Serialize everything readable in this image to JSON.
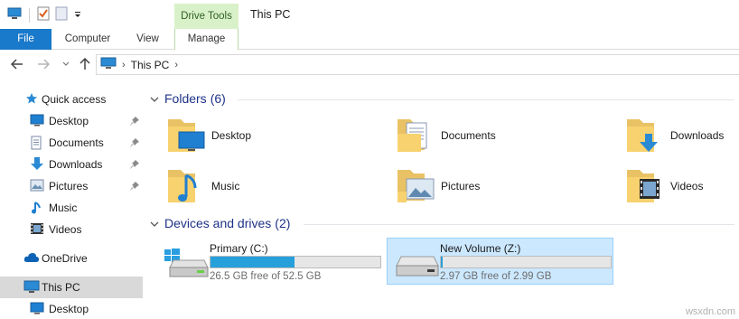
{
  "window": {
    "title": "This PC",
    "context_group": "Drive Tools"
  },
  "ribbon": {
    "tabs": [
      {
        "label": "File"
      },
      {
        "label": "Computer"
      },
      {
        "label": "View"
      },
      {
        "label": "Manage"
      }
    ]
  },
  "address": {
    "crumbs": [
      "This PC"
    ]
  },
  "navpane": {
    "items": [
      {
        "label": "Quick access",
        "icon": "star-icon"
      },
      {
        "label": "Desktop",
        "icon": "desktop-folder-icon",
        "pinned": true
      },
      {
        "label": "Documents",
        "icon": "documents-folder-icon",
        "pinned": true
      },
      {
        "label": "Downloads",
        "icon": "downloads-folder-icon",
        "pinned": true
      },
      {
        "label": "Pictures",
        "icon": "pictures-folder-icon",
        "pinned": true
      },
      {
        "label": "Music",
        "icon": "music-folder-icon"
      },
      {
        "label": "Videos",
        "icon": "videos-folder-icon"
      },
      {
        "label": "OneDrive",
        "icon": "onedrive-cloud-icon"
      },
      {
        "label": "This PC",
        "icon": "computer-icon",
        "selected": true
      },
      {
        "label": "Desktop",
        "icon": "desktop-folder-icon"
      }
    ]
  },
  "folders": {
    "title": "Folders",
    "count": "(6)",
    "items": [
      {
        "label": "Desktop",
        "icon": "desktop-folder-icon"
      },
      {
        "label": "Documents",
        "icon": "documents-folder-icon"
      },
      {
        "label": "Downloads",
        "icon": "downloads-folder-icon"
      },
      {
        "label": "Music",
        "icon": "music-folder-icon"
      },
      {
        "label": "Pictures",
        "icon": "pictures-folder-icon"
      },
      {
        "label": "Videos",
        "icon": "videos-folder-icon"
      }
    ]
  },
  "drives": {
    "title": "Devices and drives",
    "count": "(2)",
    "items": [
      {
        "label": "Primary (C:)",
        "free_text": "26.5 GB free of 52.5 GB",
        "used_fraction": 0.495,
        "selected": false
      },
      {
        "label": "New Volume (Z:)",
        "free_text": "2.97 GB free of 2.99 GB",
        "used_fraction": 0.007,
        "selected": true
      }
    ]
  },
  "colors": {
    "file_tab": "#1979ca",
    "drive_bar_fill": "#26a0da",
    "group_title": "#1e3287",
    "selection": "#cce8ff"
  },
  "watermark": "wsxdn.com"
}
